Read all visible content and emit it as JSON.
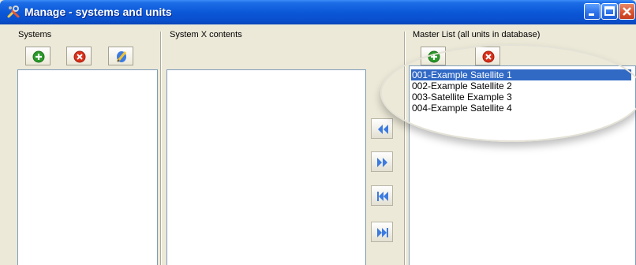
{
  "window": {
    "title": "Manage - systems and units",
    "icon": "tools-icon",
    "controls": [
      "minimize-icon",
      "maximize-icon",
      "close-icon"
    ]
  },
  "systems": {
    "label": "Systems",
    "toolbar": [
      "add-icon",
      "delete-icon",
      "edit-icon"
    ],
    "items": []
  },
  "contents": {
    "label": "System X contents",
    "items": []
  },
  "transfer_buttons": [
    "move-left-icon",
    "move-right-icon",
    "move-all-left-icon",
    "move-all-right-icon"
  ],
  "master": {
    "label": "Master List (all units in database)",
    "toolbar": [
      "add-icon",
      "delete-icon"
    ],
    "items": [
      {
        "label": "001-Example Satellite 1",
        "selected": true
      },
      {
        "label": "002-Example Satellite 2",
        "selected": false
      },
      {
        "label": "003-Satellite Example 3",
        "selected": false
      },
      {
        "label": "004-Example Satellite 4",
        "selected": false
      }
    ]
  },
  "colors": {
    "titlebar": "#0a56d6",
    "selection": "#316ac5",
    "window_bg": "#ece9d8",
    "add_green": "#2a9a2a",
    "delete_red": "#d9301a",
    "arrow_blue": "#3c7be0"
  }
}
